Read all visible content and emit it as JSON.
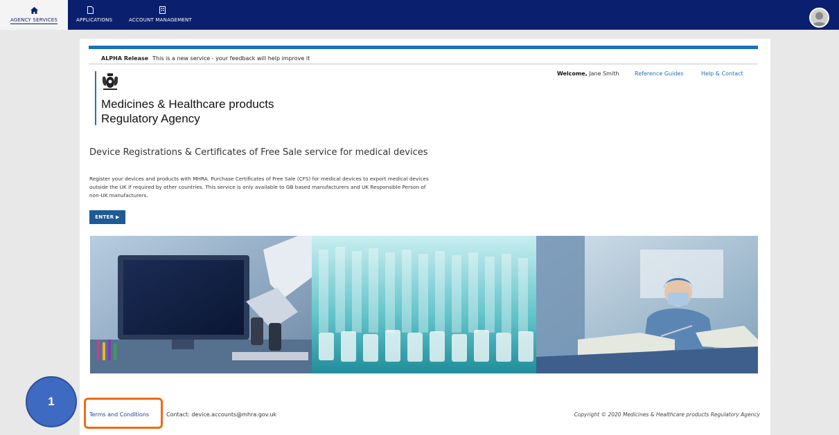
{
  "nav": {
    "tabs": [
      {
        "label": "AGENCY SERVICES",
        "icon": "home-icon"
      },
      {
        "label": "APPLICATIONS",
        "icon": "document-icon"
      },
      {
        "label": "ACCOUNT MANAGEMENT",
        "icon": "building-icon"
      }
    ],
    "avatar_icon": "user-avatar-icon"
  },
  "banner": {
    "tag": "ALPHA Release",
    "text": "This is a new service - your feedback will help improve it"
  },
  "header": {
    "org_line1": "Medicines & Healthcare products",
    "org_line2": "Regulatory Agency",
    "crest_icon": "royal-crest-icon",
    "welcome_label": "Welcome,",
    "user_name": "Jane Smith",
    "reference_guides": "Reference Guides",
    "help_contact": "Help & Contact"
  },
  "service": {
    "title": "Device Registrations & Certificates of Free Sale service for medical devices",
    "description": "Register your devices and products with MHRA. Purchase Certificates of Free Sale (CFS) for medical devices to export medical devices outside the UK if required by other countries. This service is only available to GB based manufacturers and UK Responsible Person of non-UK manufacturers.",
    "enter_label": "ENTER ▶"
  },
  "footer": {
    "terms": "Terms and Conditions",
    "contact": "Contact: device.accounts@mhra.gov.uk",
    "copyright": "Copyright © 2020 Medicines & Healthcare products Regulatory Agency"
  },
  "annotation": {
    "step_number": "1"
  },
  "colors": {
    "nav_bg": "#0b1f6f",
    "brand_blue": "#1d70b8",
    "button_blue": "#1d5a96",
    "highlight_orange": "#ee6a14",
    "callout_blue": "#3f6ac2"
  }
}
